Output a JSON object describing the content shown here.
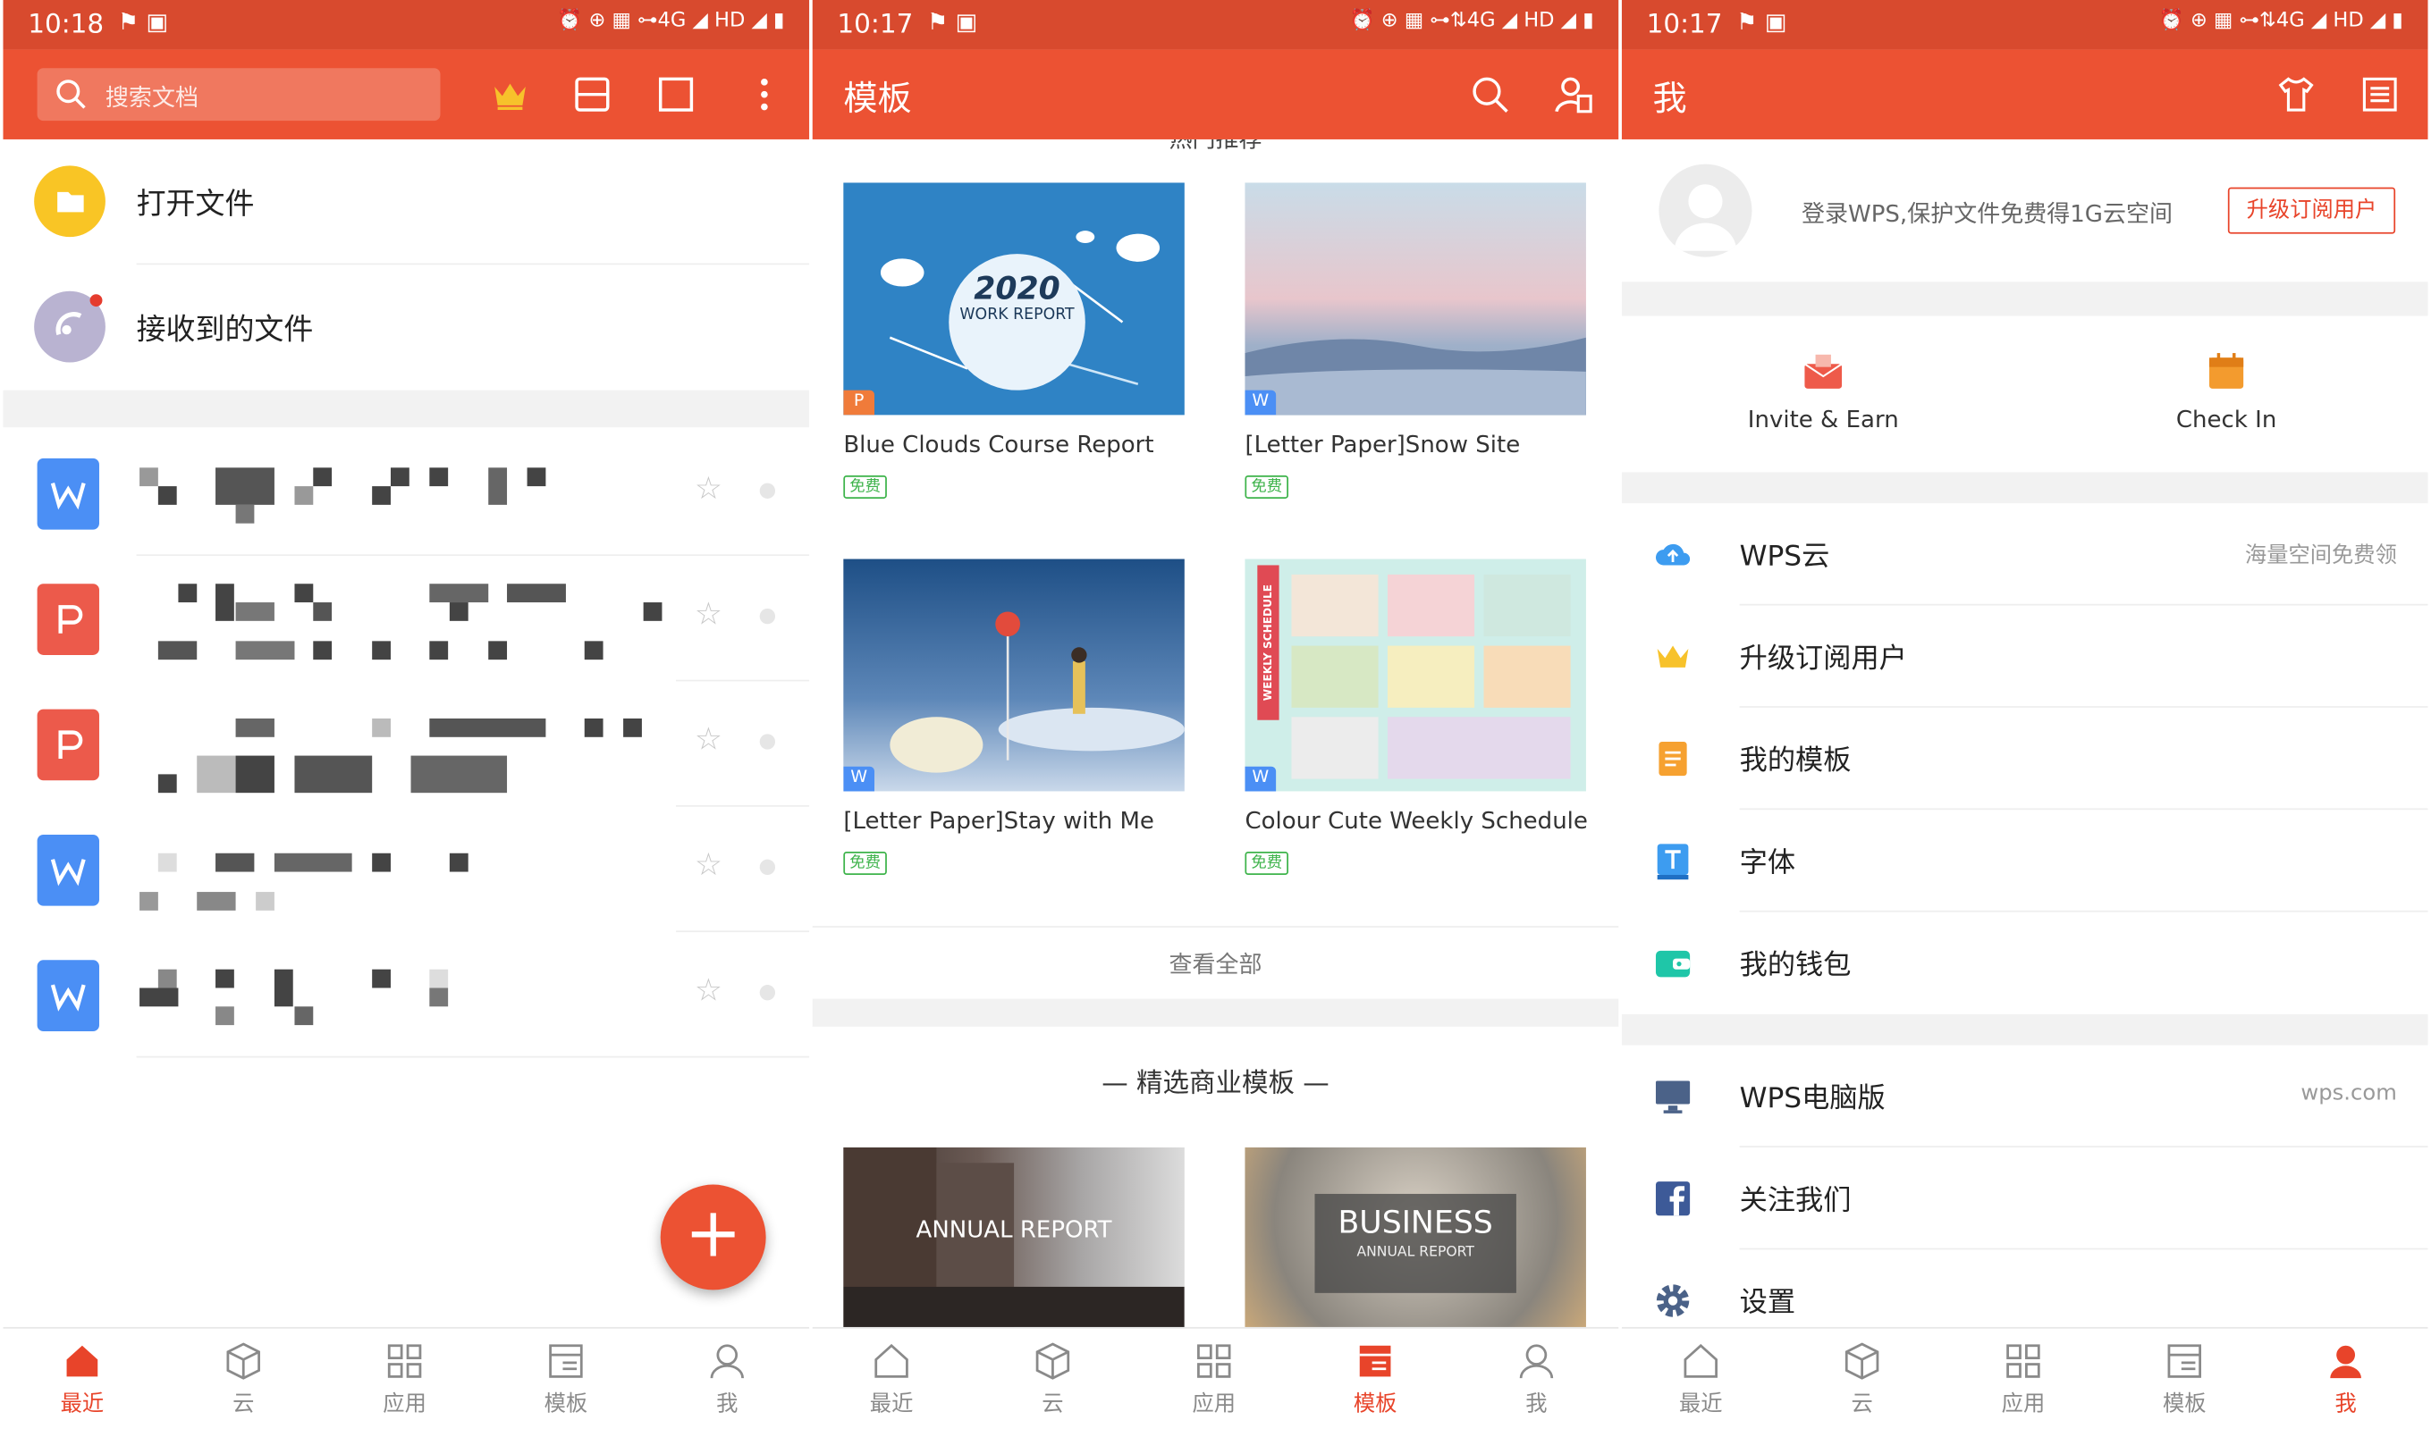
{
  "colors": {
    "accent": "#ec5233",
    "statusbar": "#d84a2e",
    "free_badge": "#3db34a"
  },
  "status": {
    "p1": {
      "time": "10:18",
      "icons": "⚑  ▣",
      "right": "⏰ ⊕ ▦ ⊶4G ◢ HD ◢ ▮"
    },
    "p2": {
      "time": "10:17",
      "icons": "⚑  ▣",
      "right": "⏰ ⊕ ▦ ⊶⇅4G ◢ HD ◢ ▮"
    },
    "p3": {
      "time": "10:17",
      "icons": "⚑  ▣",
      "right": "⏰ ⊕ ▦ ⊶⇅4G ◢ HD ◢ ▮"
    }
  },
  "recent": {
    "search_placeholder": "搜索文档",
    "open_file": "打开文件",
    "received_files": "接收到的文件",
    "files": [
      {
        "type": "writer",
        "icon": "W"
      },
      {
        "type": "pdf",
        "icon": "P"
      },
      {
        "type": "pdf",
        "icon": "P"
      },
      {
        "type": "writer",
        "icon": "W"
      },
      {
        "type": "writer",
        "icon": "W"
      }
    ],
    "fab": "+"
  },
  "templates": {
    "title": "模板",
    "cut_heading": "热门推荐",
    "cards": [
      {
        "name": "Blue Clouds Course Report",
        "badge": "免费",
        "type": "P",
        "thumb_year": "2020",
        "thumb_sub": "WORK REPORT"
      },
      {
        "name": "[Letter Paper]Snow Site",
        "badge": "免费",
        "type": "W"
      },
      {
        "name": "[Letter Paper]Stay with Me",
        "badge": "免费",
        "type": "W"
      },
      {
        "name": "Colour Cute Weekly Schedule",
        "badge": "免费",
        "type": "W",
        "thumb_side": "WEEKLY SCHEDULE"
      }
    ],
    "view_all": "查看全部",
    "business_heading": "— 精选商业模板 —",
    "business_cards": [
      {
        "thumb_text": "ANNUAL REPORT"
      },
      {
        "thumb_title": "BUSINESS",
        "thumb_sub": "ANNUAL REPORT"
      }
    ]
  },
  "me": {
    "title": "我",
    "login_text": "登录WPS,保护文件免费得1G云空间",
    "upgrade_button": "升级订阅用户",
    "invite": "Invite & Earn",
    "checkin": "Check In",
    "menu": [
      {
        "label": "WPS云",
        "right": "海量空间免费领",
        "icon": "cloud-icon"
      },
      {
        "label": "升级订阅用户",
        "right": "",
        "icon": "crown-icon"
      },
      {
        "label": "我的模板",
        "right": "",
        "icon": "template-icon"
      },
      {
        "label": "字体",
        "right": "",
        "icon": "font-icon"
      },
      {
        "label": "我的钱包",
        "right": "",
        "icon": "wallet-icon"
      },
      {
        "label": "WPS电脑版",
        "right": "wps.com",
        "icon": "monitor-icon"
      },
      {
        "label": "关注我们",
        "right": "",
        "icon": "facebook-icon"
      },
      {
        "label": "设置",
        "right": "",
        "icon": "gear-icon"
      }
    ]
  },
  "nav": {
    "recent": "最近",
    "cloud": "云",
    "apps": "应用",
    "templates": "模板",
    "me": "我"
  }
}
